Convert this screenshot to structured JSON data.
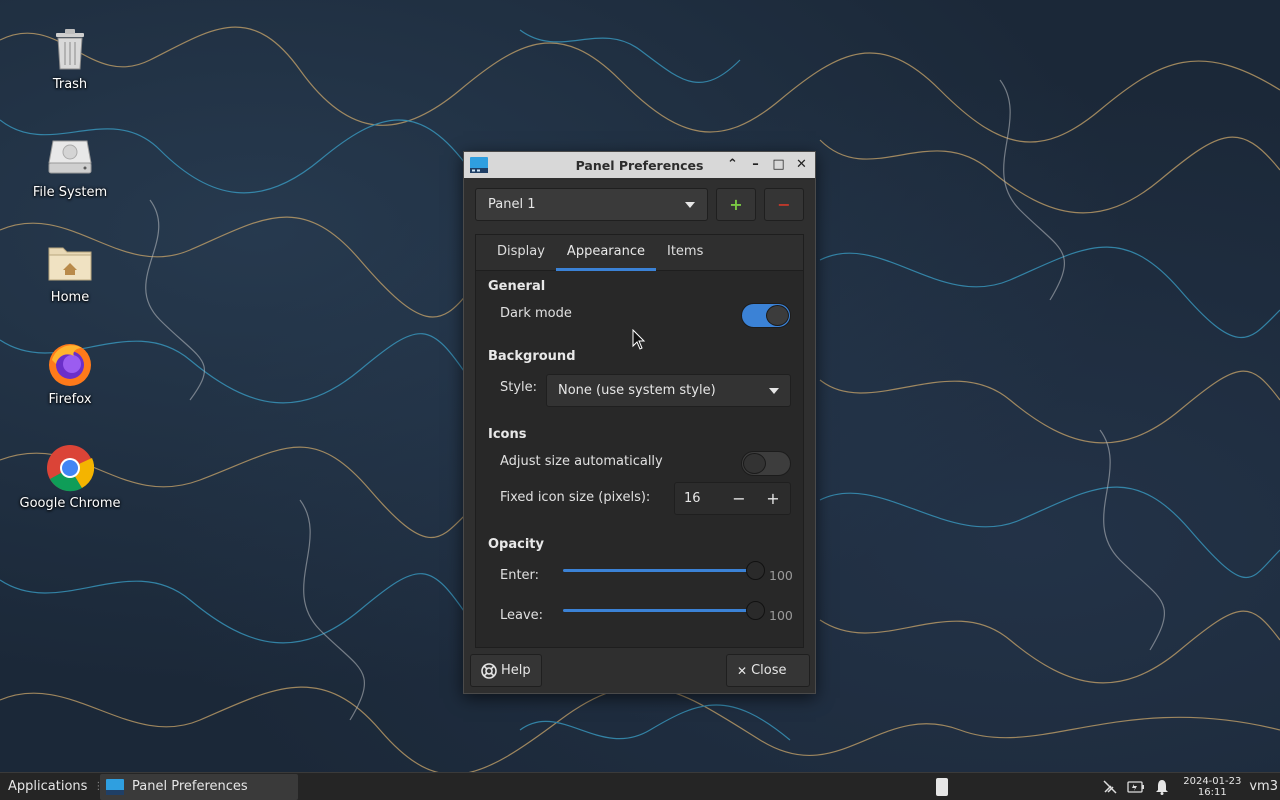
{
  "desktop": {
    "icons": [
      {
        "label": "Trash",
        "icon": "trash-icon"
      },
      {
        "label": "File System",
        "icon": "drive-icon"
      },
      {
        "label": "Home",
        "icon": "home-folder-icon"
      },
      {
        "label": "Firefox",
        "icon": "firefox-icon"
      },
      {
        "label": "Google Chrome",
        "icon": "chrome-icon"
      }
    ]
  },
  "window": {
    "title": "Panel Preferences",
    "panel_select": "Panel 1",
    "add_label": "+",
    "remove_label": "−",
    "tabs": [
      "Display",
      "Appearance",
      "Items"
    ],
    "active_tab": "Appearance",
    "general": {
      "heading": "General",
      "dark_mode_label": "Dark mode",
      "dark_mode_on": true
    },
    "background": {
      "heading": "Background",
      "style_label": "Style:",
      "style_value": "None (use system style)"
    },
    "icons": {
      "heading": "Icons",
      "adjust_label": "Adjust size automatically",
      "adjust_on": false,
      "fixed_label": "Fixed icon size (pixels):",
      "fixed_value": "16",
      "minus": "−",
      "plus": "+"
    },
    "opacity": {
      "heading": "Opacity",
      "enter_label": "Enter:",
      "enter_value": "100",
      "leave_label": "Leave:",
      "leave_value": "100"
    },
    "help_label": "Help",
    "close_label": "Close"
  },
  "taskbar": {
    "applications_label": "Applications",
    "task_label": "Panel Preferences",
    "date": "2024-01-23",
    "time": "16:11",
    "user": "vm3"
  },
  "colors": {
    "accent": "#3b82d6",
    "add_green": "#7ac943",
    "remove_red": "#c0392b"
  }
}
